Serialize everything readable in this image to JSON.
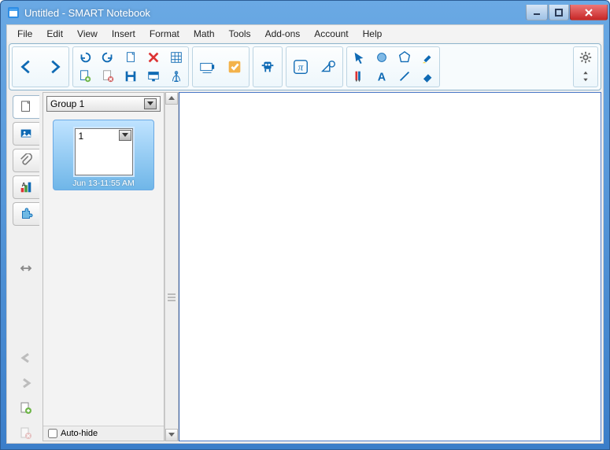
{
  "window": {
    "title": "Untitled - SMART Notebook"
  },
  "menu": {
    "items": [
      "File",
      "Edit",
      "View",
      "Insert",
      "Format",
      "Math",
      "Tools",
      "Add-ons",
      "Account",
      "Help"
    ]
  },
  "toolbar": {
    "group_nav": {
      "back": "back-arrow",
      "forward": "forward-arrow"
    },
    "group_edit": [
      "undo",
      "redo",
      "new-page",
      "delete-page",
      "open",
      "save",
      "table",
      "screenshade",
      "add-page-plus",
      "delete-page-x",
      "save2",
      "projector",
      "ruler-compass"
    ],
    "group_insert": [
      "insert-image",
      "checkbox-correct"
    ],
    "group_gadget": [
      "gadget"
    ],
    "group_math": [
      "pi",
      "shape-tool"
    ],
    "group_draw": [
      "pointer",
      "circle-tool",
      "hexagon-tool",
      "highlighter",
      "pens",
      "text-tool",
      "line-tool",
      "eraser"
    ],
    "group_settings": [
      "gear",
      "arrows-v"
    ]
  },
  "sidebar": {
    "tabs": [
      "page-sorter",
      "gallery",
      "attachments",
      "properties",
      "addons"
    ],
    "auto_hide_label": "Auto-hide",
    "group_label": "Group 1",
    "thumb": {
      "number": "1",
      "timestamp": "Jun 13-11:55 AM"
    }
  },
  "colors": {
    "accent": "#0f6ab4",
    "accent_orange": "#e8a23a",
    "accent_green": "#4a9a3e",
    "accent_red": "#c43a3a"
  }
}
